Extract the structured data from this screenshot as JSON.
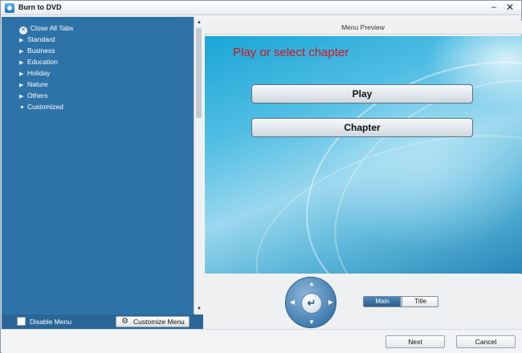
{
  "window": {
    "title": "Burn to DVD",
    "minimize_label": "–",
    "close_label": "✕"
  },
  "sidebar": {
    "close_all_label": "Close All Tabs",
    "items": [
      {
        "label": "Standard",
        "state": "collapsed"
      },
      {
        "label": "Business",
        "state": "collapsed"
      },
      {
        "label": "Education",
        "state": "collapsed"
      },
      {
        "label": "Holiday",
        "state": "collapsed"
      },
      {
        "label": "Nature",
        "state": "collapsed"
      },
      {
        "label": "Others",
        "state": "collapsed"
      },
      {
        "label": "Customized",
        "state": "expanded"
      }
    ],
    "disable_menu_label": "Disable Menu",
    "customize_menu_label": "Customize Menu"
  },
  "preview": {
    "header": "Menu Preview",
    "caption": "Play or select chapter",
    "caption_color": "#d9121f",
    "play_label": "Play",
    "chapter_label": "Chapter"
  },
  "controls": {
    "tabs": [
      {
        "label": "Main",
        "selected": true
      },
      {
        "label": "Title",
        "selected": false
      }
    ]
  },
  "footer": {
    "next_label": "Next",
    "cancel_label": "Cancel"
  },
  "colors": {
    "sidebar_bg": "#2e73a8",
    "accent": "#2c5f8f"
  }
}
